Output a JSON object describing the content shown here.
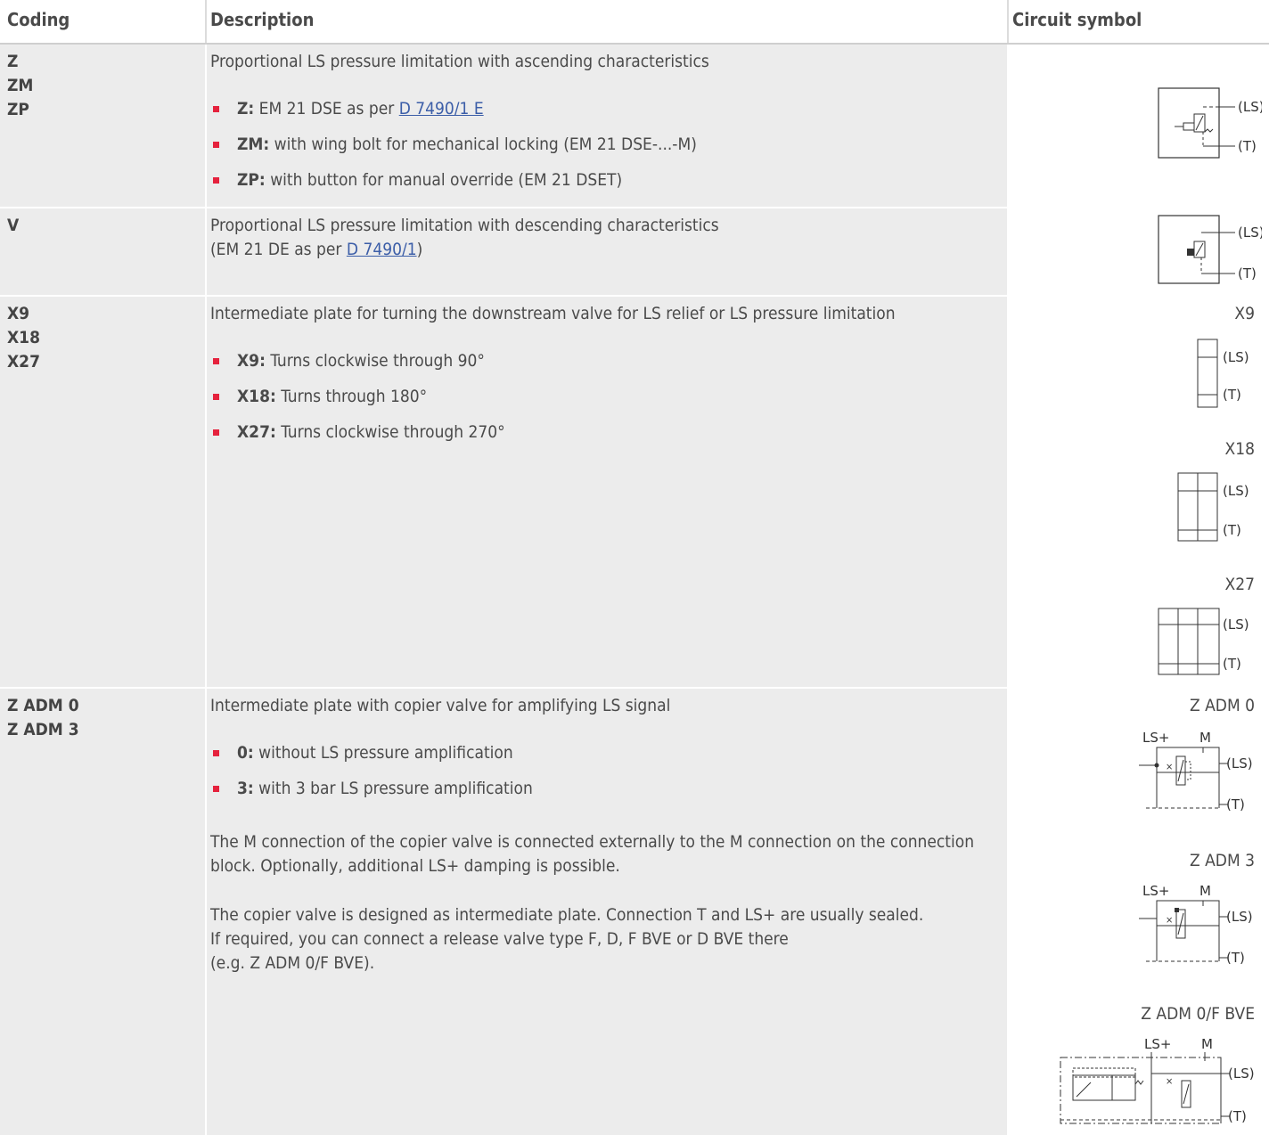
{
  "header": {
    "coding": "Coding",
    "description": "Description",
    "symbol": "Circuit symbol"
  },
  "rows": [
    {
      "codes": [
        "Z",
        "ZM",
        "ZP"
      ],
      "intro": "Proportional LS pressure limitation with ascending characteristics",
      "bullets": [
        {
          "key": "Z:",
          "text": " EM 21 DSE as per ",
          "link": "D 7490/1 E"
        },
        {
          "key": "ZM:",
          "text": " with wing bolt for mechanical locking (EM 21 DSE-...-M)"
        },
        {
          "key": "ZP:",
          "text": " with button for manual override (EM 21 DSET)"
        }
      ]
    },
    {
      "codes": [
        "V"
      ],
      "line1": "Proportional LS pressure limitation with descending characteristics",
      "line2_pre": "(EM 21 DE as per ",
      "line2_link": "D 7490/1",
      "line2_post": ")"
    },
    {
      "codes": [
        "X9",
        "X18",
        "X27"
      ],
      "intro": "Intermediate plate for turning the downstream valve for LS relief or LS pressure limitation",
      "bullets": [
        {
          "key": "X9:",
          "text": " Turns clockwise through 90°"
        },
        {
          "key": "X18:",
          "text": " Turns through 180°"
        },
        {
          "key": "X27:",
          "text": " Turns clockwise through 270°"
        }
      ],
      "symbol_labels": [
        "X9",
        "X18",
        "X27"
      ]
    },
    {
      "codes": [
        "Z ADM 0",
        "Z ADM 3"
      ],
      "intro": "Intermediate plate with copier valve for amplifying LS signal",
      "bullets": [
        {
          "key": "0:",
          "text": " without LS pressure amplification"
        },
        {
          "key": "3:",
          "text": " with 3 bar LS pressure amplification"
        }
      ],
      "para1": "The M connection of the copier valve is connected externally to the M connection on the connection block. Optionally, additional LS+ damping is possible.",
      "para2a": "The copier valve is designed as intermediate plate. Connection T and LS+ are usually sealed.",
      "para2b": "If required, you can connect a release valve type F, D, F BVE or D BVE there",
      "para2c": "(e.g. Z ADM 0/F BVE).",
      "symbol_labels": [
        "Z ADM 0",
        "Z ADM 3",
        "Z ADM 0/F BVE"
      ]
    }
  ],
  "port_labels": {
    "ls": "(LS)",
    "t": "(T)",
    "lsplus": "LS+",
    "m": "M"
  }
}
